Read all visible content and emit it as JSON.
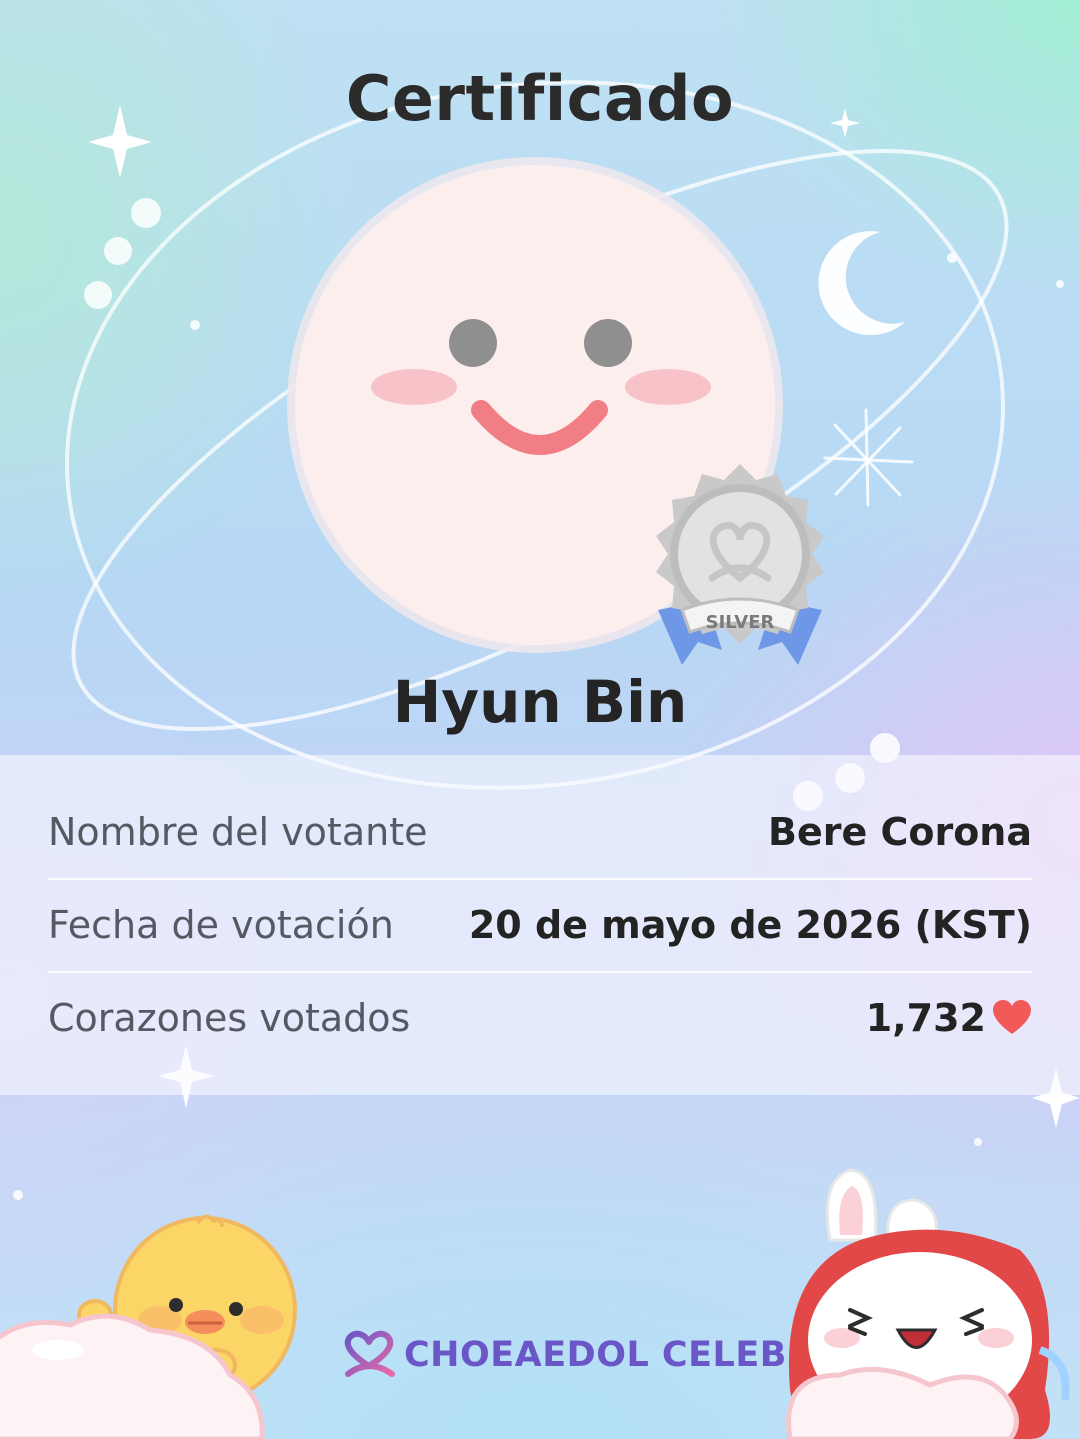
{
  "certificate": {
    "title": "Certificado",
    "celebrity_name": "Hyun Bin",
    "badge_label": "SILVER",
    "badge_icon": "silver-medal-icon",
    "avatar_icon": "smiley-face-icon"
  },
  "details": [
    {
      "label": "Nombre del votante",
      "value": "Bere Corona"
    },
    {
      "label": "Fecha de votación",
      "value": "20 de mayo de 2026 (KST)"
    },
    {
      "label": "Corazones votados",
      "value": "1,732",
      "icon": "heart-icon"
    }
  ],
  "brand": {
    "name": "CHOEAEDOL CELEB",
    "logo_icon": "heart-loop-logo-icon"
  },
  "colors": {
    "heart": "#f25a5a",
    "brand": "#6b56c8",
    "title": "#2b2b2b",
    "badge_ribbon": "#6f97e8"
  }
}
